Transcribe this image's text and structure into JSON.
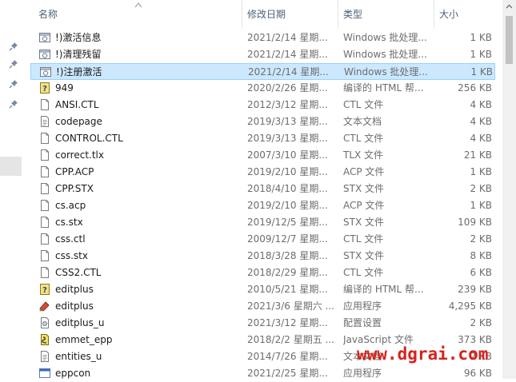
{
  "columns": {
    "name": "名称",
    "date": "修改日期",
    "type": "类型",
    "size": "大小"
  },
  "selected_index": 2,
  "files": [
    {
      "name": "!)激活信息",
      "date": "2021/2/14 星期...",
      "type": "Windows 批处理...",
      "size": "1 KB",
      "icon": "batch-file-icon"
    },
    {
      "name": "!)清理残留",
      "date": "2021/2/14 星期...",
      "type": "Windows 批处理...",
      "size": "1 KB",
      "icon": "batch-file-icon"
    },
    {
      "name": "!)注册激活",
      "date": "2021/2/14 星期...",
      "type": "Windows 批处理...",
      "size": "1 KB",
      "icon": "batch-file-icon"
    },
    {
      "name": "949",
      "date": "2020/2/26 星期...",
      "type": "编译的 HTML 帮...",
      "size": "256 KB",
      "icon": "chm-help-icon"
    },
    {
      "name": "ANSI.CTL",
      "date": "2012/3/12 星期...",
      "type": "CTL 文件",
      "size": "4 KB",
      "icon": "file-icon"
    },
    {
      "name": "codepage",
      "date": "2019/3/13 星期...",
      "type": "文本文档",
      "size": "4 KB",
      "icon": "text-file-icon"
    },
    {
      "name": "CONTROL.CTL",
      "date": "2019/3/13 星期...",
      "type": "CTL 文件",
      "size": "4 KB",
      "icon": "file-icon"
    },
    {
      "name": "correct.tlx",
      "date": "2007/3/10 星期...",
      "type": "TLX 文件",
      "size": "21 KB",
      "icon": "file-icon"
    },
    {
      "name": "CPP.ACP",
      "date": "2019/2/10 星期...",
      "type": "ACP 文件",
      "size": "1 KB",
      "icon": "file-icon"
    },
    {
      "name": "CPP.STX",
      "date": "2018/4/10 星期...",
      "type": "STX 文件",
      "size": "2 KB",
      "icon": "file-icon"
    },
    {
      "name": "cs.acp",
      "date": "2019/2/10 星期...",
      "type": "ACP 文件",
      "size": "1 KB",
      "icon": "file-icon"
    },
    {
      "name": "cs.stx",
      "date": "2019/12/5 星期...",
      "type": "STX 文件",
      "size": "109 KB",
      "icon": "file-icon"
    },
    {
      "name": "css.ctl",
      "date": "2009/12/7 星期...",
      "type": "CTL 文件",
      "size": "2 KB",
      "icon": "file-icon"
    },
    {
      "name": "css.stx",
      "date": "2018/3/28 星期...",
      "type": "STX 文件",
      "size": "8 KB",
      "icon": "file-icon"
    },
    {
      "name": "CSS2.CTL",
      "date": "2018/2/29 星期...",
      "type": "CTL 文件",
      "size": "6 KB",
      "icon": "file-icon"
    },
    {
      "name": "editplus",
      "date": "2010/5/21 星期...",
      "type": "编译的 HTML 帮...",
      "size": "239 KB",
      "icon": "chm-help-icon"
    },
    {
      "name": "editplus",
      "date": "2021/3/6 星期六 ...",
      "type": "应用程序",
      "size": "4,295 KB",
      "icon": "editplus-app-icon"
    },
    {
      "name": "editplus_u",
      "date": "2021/3/12 星期...",
      "type": "配置设置",
      "size": "2 KB",
      "icon": "config-file-icon"
    },
    {
      "name": "emmet_epp",
      "date": "2018/2/2 星期五 ...",
      "type": "JavaScript 文件",
      "size": "373 KB",
      "icon": "javascript-file-icon"
    },
    {
      "name": "entities_u",
      "date": "2014/7/26 星期...",
      "type": "文本文档",
      "size": "2 KB",
      "icon": "text-file-icon"
    },
    {
      "name": "eppcon",
      "date": "2021/2/25 星期...",
      "type": "应用程序",
      "size": "96 KB",
      "icon": "app-icon"
    }
  ],
  "watermark": "www.dgrai.com",
  "colors": {
    "selection": "#cce8ff",
    "selection_border": "#99d1ff",
    "header_text": "#4c607a",
    "meta_text": "#6d6d6d",
    "watermark": "#d6221b"
  }
}
